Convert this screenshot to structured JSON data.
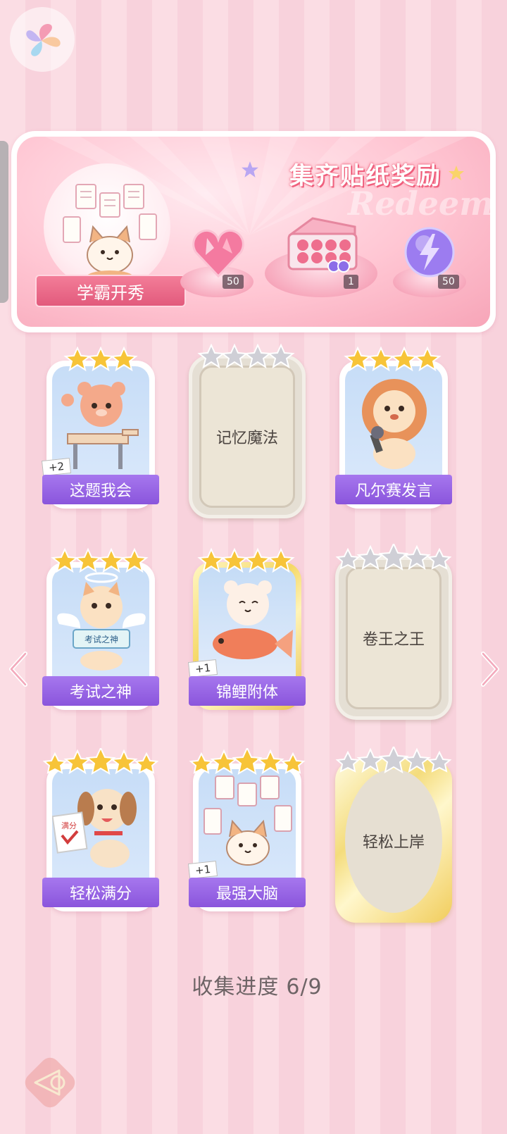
{
  "banner": {
    "title": "集齐贴纸奖励",
    "subtitle": "Redeem",
    "main_sticker_label": "学霸开秀",
    "rewards": [
      {
        "icon": "heart-gem-icon",
        "count": "50"
      },
      {
        "icon": "gift-box-icon",
        "count": "1"
      },
      {
        "icon": "lightning-orb-icon",
        "count": "50"
      }
    ]
  },
  "stickers": [
    {
      "label": "这题我会",
      "collected": true,
      "stars": 3,
      "bonus": "+2",
      "art": "bear-at-desk-icon"
    },
    {
      "label": "记忆魔法",
      "collected": false,
      "stars": 4,
      "bonus": "",
      "art": ""
    },
    {
      "label": "凡尔赛发言",
      "collected": true,
      "stars": 4,
      "bonus": "",
      "art": "lion-microphone-icon"
    },
    {
      "label": "考试之神",
      "collected": true,
      "stars": 4,
      "bonus": "",
      "art": "angel-cat-icon",
      "sign": "考试之神"
    },
    {
      "label": "锦鲤附体",
      "collected": true,
      "stars": 4,
      "bonus": "+1",
      "art": "bear-koi-icon"
    },
    {
      "label": "卷王之王",
      "collected": false,
      "stars": 5,
      "bonus": "",
      "art": ""
    },
    {
      "label": "轻松满分",
      "collected": true,
      "stars": 5,
      "bonus": "",
      "art": "puppy-full-score-icon",
      "sign": "满分"
    },
    {
      "label": "最强大脑",
      "collected": true,
      "stars": 5,
      "bonus": "+1",
      "art": "cat-papers-icon"
    },
    {
      "label": "轻松上岸",
      "collected": false,
      "stars": 5,
      "bonus": "",
      "art": ""
    }
  ],
  "progress": {
    "label": "收集进度",
    "value": "6/9"
  },
  "colors": {
    "label_purple": "#9462e4",
    "star_gold": "#f7c438",
    "star_silver": "#c9c9cf",
    "banner_pink": "#f7a5b8"
  }
}
